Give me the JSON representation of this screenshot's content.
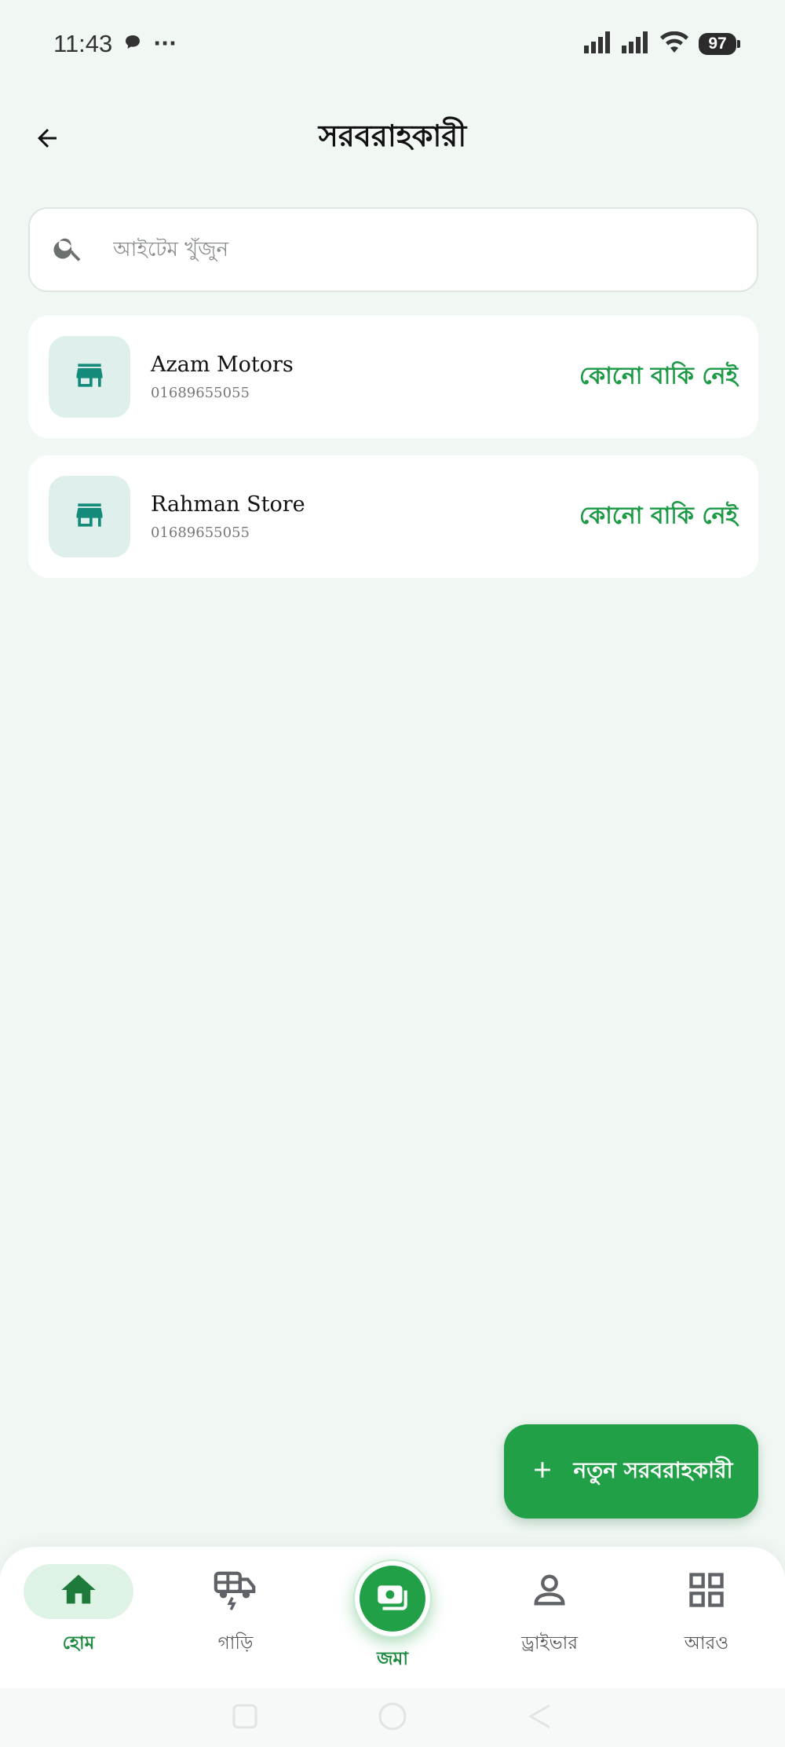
{
  "status_bar": {
    "time": "11:43",
    "more": "···",
    "battery": "97"
  },
  "header": {
    "title": "সরবরাহকারী"
  },
  "search": {
    "placeholder": "আইটেম খুঁজুন"
  },
  "suppliers": [
    {
      "name": "Azam Motors",
      "phone": "01689655055",
      "status": "কোনো বাকি নেই"
    },
    {
      "name": "Rahman Store",
      "phone": "01689655055",
      "status": "কোনো বাকি নেই"
    }
  ],
  "fab": {
    "label": "নতুন সরবরাহকারী"
  },
  "bottom_nav": {
    "items": [
      {
        "label": "হোম",
        "icon": "home-icon",
        "active": true
      },
      {
        "label": "গাড়ি",
        "icon": "vehicle-icon",
        "active": false
      },
      {
        "label": "জমা",
        "icon": "cash-deposit-icon",
        "active": false
      },
      {
        "label": "ড্রাইভার",
        "icon": "person-icon",
        "active": false
      },
      {
        "label": "আরও",
        "icon": "grid-icon",
        "active": false
      }
    ]
  },
  "colors": {
    "accent": "#22a048",
    "status_green": "#1d9a45",
    "background": "#f1f7f3",
    "avatar_bg": "#dff0ec"
  }
}
